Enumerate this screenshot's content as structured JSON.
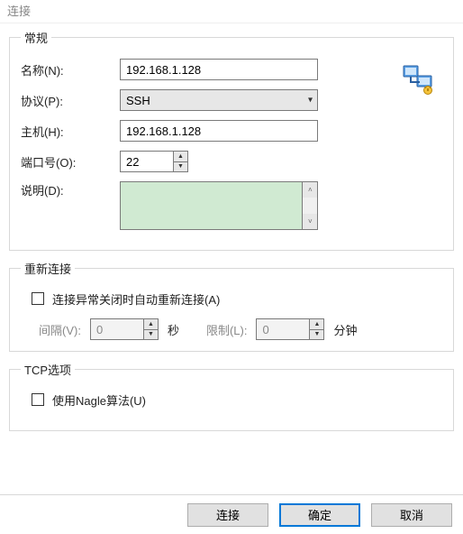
{
  "window": {
    "title": "连接"
  },
  "general": {
    "legend": "常规",
    "name_label": "名称(N):",
    "name_value": "192.168.1.128",
    "protocol_label": "协议(P):",
    "protocol_value": "SSH",
    "host_label": "主机(H):",
    "host_value": "192.168.1.128",
    "port_label": "端口号(O):",
    "port_value": "22",
    "desc_label": "说明(D):",
    "desc_value": ""
  },
  "reconnect": {
    "legend": "重新连接",
    "auto_label": "连接异常关闭时自动重新连接(A)",
    "auto_checked": false,
    "interval_label": "间隔(V):",
    "interval_value": "0",
    "interval_unit": "秒",
    "limit_label": "限制(L):",
    "limit_value": "0",
    "limit_unit": "分钟"
  },
  "tcp": {
    "legend": "TCP选项",
    "nagle_label": "使用Nagle算法(U)",
    "nagle_checked": false
  },
  "buttons": {
    "connect": "连接",
    "ok": "确定",
    "cancel": "取消"
  }
}
